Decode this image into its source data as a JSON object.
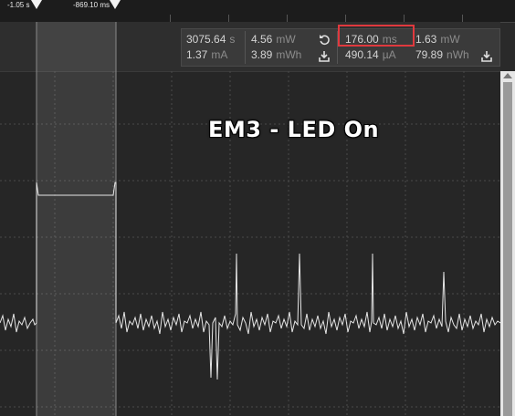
{
  "ruler": {
    "markers": [
      {
        "label": "-1.05 s"
      },
      {
        "label": "-869.10 ms"
      }
    ]
  },
  "stats": {
    "group1": {
      "time": {
        "value": "3075.64",
        "unit": "s"
      },
      "current": {
        "value": "1.37",
        "unit": "mA"
      },
      "power": {
        "value": "4.56",
        "unit": "mW"
      },
      "energy": {
        "value": "3.89",
        "unit": "mWh"
      }
    },
    "group2": {
      "time": {
        "value": "176.00",
        "unit": "ms"
      },
      "current": {
        "value": "490.14",
        "unit": "µA"
      },
      "power": {
        "value": "1.63",
        "unit": "mW"
      },
      "energy": {
        "value": "79.89",
        "unit": "nWh"
      }
    }
  },
  "icons": {
    "reset": "reset-icon",
    "export1": "export-icon",
    "export2": "export-icon"
  },
  "annotation": {
    "text": "EM3 - LED On"
  },
  "colors": {
    "background": "#262626",
    "trace": "#e6e6e6",
    "highlight": "#e0393e",
    "selection": "#3a3a3a"
  }
}
